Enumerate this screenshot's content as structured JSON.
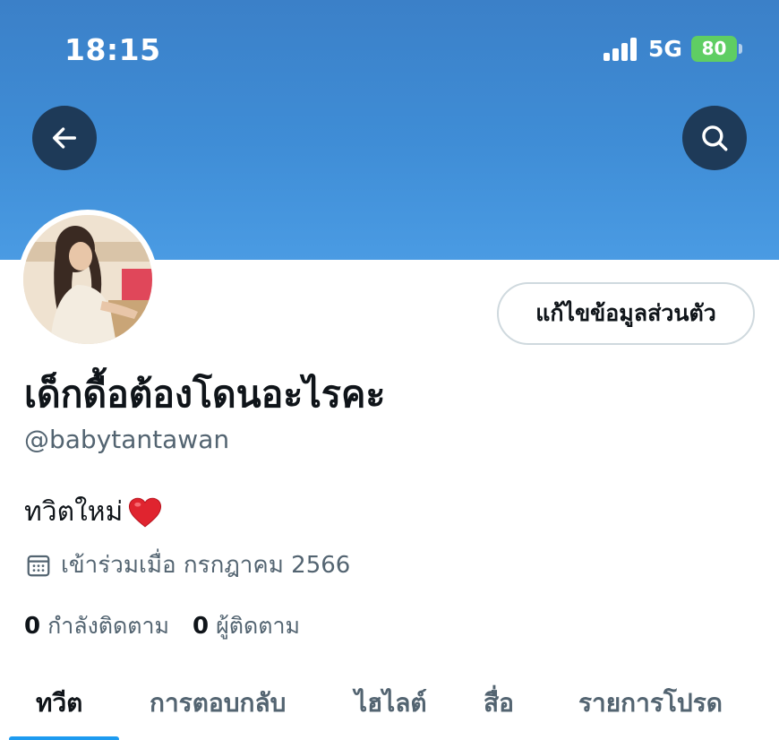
{
  "status_bar": {
    "time": "18:15",
    "network": "5G",
    "battery": "80"
  },
  "header": {
    "back_icon": "arrow-left-icon",
    "search_icon": "search-icon",
    "banner_color": "#3f8dd6"
  },
  "profile": {
    "edit_button_label": "แก้ไขข้อมูลส่วนตัว",
    "display_name": "เด็กดื้อต้องโดนอะไรคะ",
    "handle": "@babytantawan",
    "bio": "ทวิตใหม่",
    "bio_emoji_icon": "red-heart-icon",
    "joined": "เข้าร่วมเมื่อ กรกฎาคม 2566",
    "following_count": "0",
    "following_label": "กำลังติดตาม",
    "followers_count": "0",
    "followers_label": "ผู้ติดตาม"
  },
  "tabs": [
    {
      "label": "ทวีต",
      "active": true
    },
    {
      "label": "การตอบกลับ",
      "active": false
    },
    {
      "label": "ไฮไลต์",
      "active": false
    },
    {
      "label": "สื่อ",
      "active": false
    },
    {
      "label": "รายการโปรด",
      "active": false
    }
  ],
  "colors": {
    "accent": "#1d9bf0",
    "text_primary": "#0f1419",
    "text_secondary": "#536471",
    "button_dark": "#1e3a58",
    "battery_green": "#5fce63"
  }
}
